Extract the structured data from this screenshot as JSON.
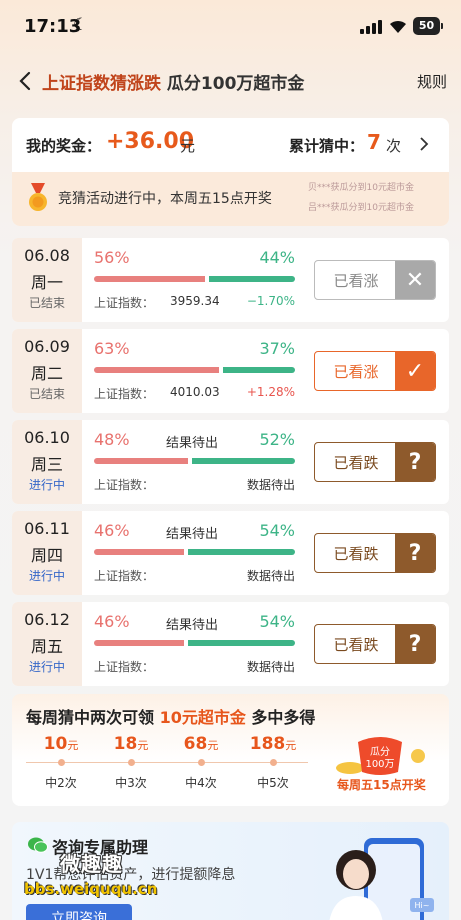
{
  "status_bar": {
    "time": "17:13",
    "battery": "50"
  },
  "header": {
    "title": "上证指数猜涨跌",
    "subtitle": " 瓜分100万超市金",
    "rules_label": "规则"
  },
  "prize": {
    "label": "我的奖金：",
    "value": "+36.00",
    "unit": "元",
    "total_label": "累计猜中：",
    "total_value": "7",
    "total_unit": "次",
    "notice": "竞猜活动进行中，本周五15点开奖",
    "marquee": [
      "贝***获瓜分到10元超市金",
      "吕***获瓜分到10元超市金"
    ]
  },
  "index_label": "上证指数：",
  "pending_label": "结果待出",
  "data_pending_label": "数据待出",
  "days": [
    {
      "date": "06.08",
      "weekday": "周一",
      "status": "已结束",
      "up_pct": "56%",
      "down_pct": "44%",
      "up_ratio": 0.56,
      "index": "3959.34",
      "change": "−1.70%",
      "change_color": "#3db487",
      "vote": "已看涨",
      "vote_mark": "✕",
      "style": "grey",
      "active": false
    },
    {
      "date": "06.09",
      "weekday": "周二",
      "status": "已结束",
      "up_pct": "63%",
      "down_pct": "37%",
      "up_ratio": 0.63,
      "index": "4010.03",
      "change": "+1.28%",
      "change_color": "#e8554e",
      "vote": "已看涨",
      "vote_mark": "✓",
      "style": "orange",
      "active": false
    },
    {
      "date": "06.10",
      "weekday": "周三",
      "status": "进行中",
      "up_pct": "48%",
      "down_pct": "52%",
      "up_ratio": 0.48,
      "index": "",
      "change": "",
      "vote": "已看跌",
      "vote_mark": "?",
      "style": "brown",
      "active": true
    },
    {
      "date": "06.11",
      "weekday": "周四",
      "status": "进行中",
      "up_pct": "46%",
      "down_pct": "54%",
      "up_ratio": 0.46,
      "index": "",
      "change": "",
      "vote": "已看跌",
      "vote_mark": "?",
      "style": "brown",
      "active": true
    },
    {
      "date": "06.12",
      "weekday": "周五",
      "status": "进行中",
      "up_pct": "46%",
      "down_pct": "54%",
      "up_ratio": 0.46,
      "index": "",
      "change": "",
      "vote": "已看跌",
      "vote_mark": "?",
      "style": "brown",
      "active": true
    }
  ],
  "reward": {
    "title_prefix": "每周猜中两次可领 ",
    "title_highlight": "10元超市金",
    "title_suffix": " 多中多得",
    "tiers": [
      {
        "amount": "10",
        "unit": "元",
        "count": "中2次"
      },
      {
        "amount": "18",
        "unit": "元",
        "count": "中3次"
      },
      {
        "amount": "68",
        "unit": "元",
        "count": "中4次"
      },
      {
        "amount": "188",
        "unit": "元",
        "count": "中5次"
      }
    ],
    "badge_line1": "瓜分",
    "badge_line2": "100万",
    "note": "每周五15点开奖"
  },
  "advisor": {
    "title": "咨询专属助理",
    "desc": "1V1帮您评估资产，进行提额降息",
    "button": "立即咨询",
    "bubble": "Hi~"
  },
  "watermark": {
    "line1": "微趣趣",
    "line2": "bbs.weiququ.cn"
  }
}
